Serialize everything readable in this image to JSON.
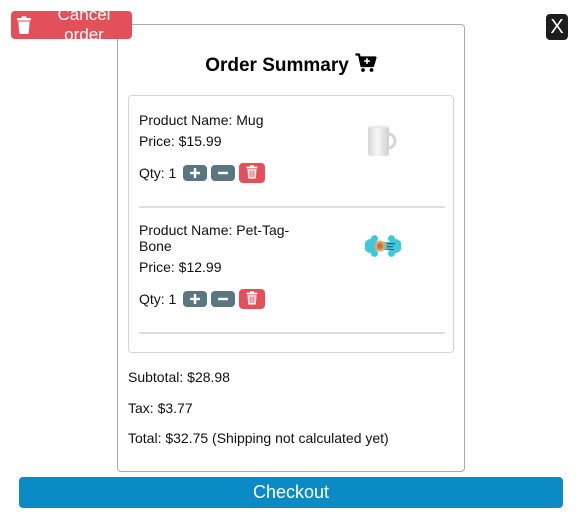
{
  "cancel_button": {
    "label": "Cancel order",
    "icon": "trash-icon",
    "color": "#e4505a"
  },
  "close_button": {
    "label": "X"
  },
  "summary": {
    "title": "Order Summary",
    "title_icon": "cart-icon",
    "items": [
      {
        "name": "Product Name: Mug",
        "price": "Price: $15.99",
        "qty_label": "Qty: 1",
        "image": "mug-image"
      },
      {
        "name": "Product Name: Pet-Tag-Bone",
        "price": "Price: $12.99",
        "qty_label": "Qty: 1",
        "image": "pet-tag-bone-image"
      }
    ],
    "subtotal": "Subtotal: $28.98",
    "tax": "Tax: $3.77",
    "total": "Total: $32.75 (Shipping not calculated yet)"
  },
  "checkout_button": {
    "label": "Checkout",
    "color": "#0a8bc6"
  },
  "colors": {
    "delete": "#e4505a",
    "qty_button": "#5a7680",
    "checkout": "#0a8bc6",
    "close": "#1d1d1d"
  }
}
